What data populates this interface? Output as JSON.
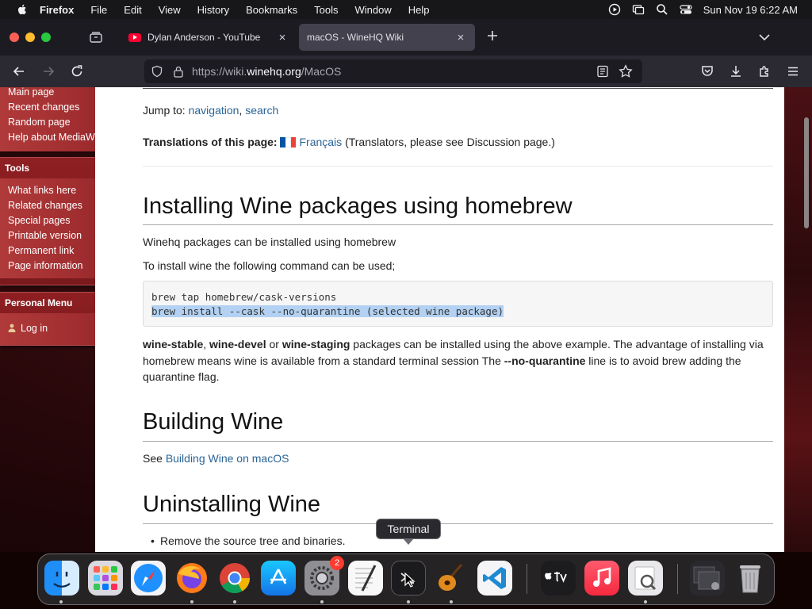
{
  "menubar": {
    "app_name": "Firefox",
    "menus": [
      "File",
      "Edit",
      "View",
      "History",
      "Bookmarks",
      "Tools",
      "Window",
      "Help"
    ],
    "clock": "Sun Nov 19  6:22 AM"
  },
  "tabs": [
    {
      "title": "Dylan Anderson - YouTube",
      "close": "×"
    },
    {
      "title": "macOS - WineHQ Wiki",
      "close": "×"
    }
  ],
  "urlbar": {
    "prefix": "https://wiki.",
    "domain": "winehq.org",
    "path": "/MacOS"
  },
  "sidebar": {
    "navigation_items": [
      "Main page",
      "Recent changes",
      "Random page",
      "Help about MediaWiki"
    ],
    "tools": {
      "title": "Tools",
      "items": [
        "What links here",
        "Related changes",
        "Special pages",
        "Printable version",
        "Permanent link",
        "Page information"
      ]
    },
    "personal": {
      "title": "Personal Menu",
      "login": "Log in"
    }
  },
  "page": {
    "jump_label": "Jump to:",
    "jump_nav": "navigation",
    "jump_sep": ",",
    "jump_search": "search",
    "translations_label": "Translations of this page:",
    "translations_link": "Français",
    "translations_note": "(Translators, please see Discussion page.)",
    "h_install": "Installing Wine packages using homebrew",
    "p1": "Winehq packages can be installed using homebrew",
    "p2": "To install wine the following command can be used;",
    "code_line1": "brew tap homebrew/cask-versions",
    "code_line2": "brew install --cask --no-quarantine (selected wine package)",
    "p3_b1": "wine-stable",
    "p3_t1": ", ",
    "p3_b2": "wine-devel",
    "p3_t2": " or ",
    "p3_b3": "wine-staging",
    "p3_t3": " packages can be installed using the above example. The advantage of installing via homebrew means wine is available from a standard terminal session The ",
    "p3_b4": "--no-quarantine",
    "p3_t4": " line is to avoid brew adding the quarantine flag.",
    "h_build": "Building Wine",
    "p4_pre": "See ",
    "p4_link": "Building Wine on macOS",
    "h_uninstall": "Uninstalling Wine",
    "bullet1": "Remove the source tree and binaries."
  },
  "tooltip": "Terminal",
  "dock": {
    "apps": [
      "Finder",
      "Launchpad",
      "Safari",
      "Firefox",
      "Chrome",
      "App Store",
      "System Settings",
      "TextEdit",
      "Terminal",
      "GarageBand",
      "Visual Studio Code",
      "TV",
      "Music",
      "Preview",
      "Downloads",
      "Trash"
    ],
    "settings_badge": "2"
  },
  "colors": {
    "link": "#2a6496",
    "sidebar_red": "#8e1f22",
    "selection": "#b3d1f2",
    "active_tab": "#42414d"
  }
}
